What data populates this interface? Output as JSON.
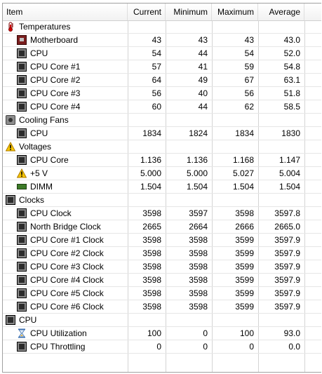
{
  "columns": {
    "item": "Item",
    "current": "Current",
    "minimum": "Minimum",
    "maximum": "Maximum",
    "average": "Average"
  },
  "rows": [
    {
      "type": "group",
      "icon": "thermometer-icon",
      "label": "Temperatures"
    },
    {
      "type": "item",
      "icon": "motherboard-icon",
      "label": "Motherboard",
      "current": "43",
      "minimum": "43",
      "maximum": "43",
      "average": "43.0"
    },
    {
      "type": "item",
      "icon": "cpu-chip-icon",
      "label": "CPU",
      "current": "54",
      "minimum": "44",
      "maximum": "54",
      "average": "52.0"
    },
    {
      "type": "item",
      "icon": "cpu-chip-icon",
      "label": "CPU Core #1",
      "current": "57",
      "minimum": "41",
      "maximum": "59",
      "average": "54.8"
    },
    {
      "type": "item",
      "icon": "cpu-chip-icon",
      "label": "CPU Core #2",
      "current": "64",
      "minimum": "49",
      "maximum": "67",
      "average": "63.1"
    },
    {
      "type": "item",
      "icon": "cpu-chip-icon",
      "label": "CPU Core #3",
      "current": "56",
      "minimum": "40",
      "maximum": "56",
      "average": "51.8"
    },
    {
      "type": "item",
      "icon": "cpu-chip-icon",
      "label": "CPU Core #4",
      "current": "60",
      "minimum": "44",
      "maximum": "62",
      "average": "58.5"
    },
    {
      "type": "group",
      "icon": "fan-icon",
      "label": "Cooling Fans"
    },
    {
      "type": "item",
      "icon": "cpu-chip-icon",
      "label": "CPU",
      "current": "1834",
      "minimum": "1824",
      "maximum": "1834",
      "average": "1830"
    },
    {
      "type": "group",
      "icon": "warning-icon",
      "label": "Voltages"
    },
    {
      "type": "item",
      "icon": "cpu-chip-icon",
      "label": "CPU Core",
      "current": "1.136",
      "minimum": "1.136",
      "maximum": "1.168",
      "average": "1.147"
    },
    {
      "type": "item",
      "icon": "warning-icon",
      "label": "+5 V",
      "current": "5.000",
      "minimum": "5.000",
      "maximum": "5.027",
      "average": "5.004"
    },
    {
      "type": "item",
      "icon": "dimm-icon",
      "label": "DIMM",
      "current": "1.504",
      "minimum": "1.504",
      "maximum": "1.504",
      "average": "1.504"
    },
    {
      "type": "group",
      "icon": "clock-chip-icon",
      "label": "Clocks"
    },
    {
      "type": "item",
      "icon": "cpu-chip-icon",
      "label": "CPU Clock",
      "current": "3598",
      "minimum": "3597",
      "maximum": "3598",
      "average": "3597.8"
    },
    {
      "type": "item",
      "icon": "northbridge-icon",
      "label": "North Bridge Clock",
      "current": "2665",
      "minimum": "2664",
      "maximum": "2666",
      "average": "2665.0"
    },
    {
      "type": "item",
      "icon": "cpu-chip-icon",
      "label": "CPU Core #1 Clock",
      "current": "3598",
      "minimum": "3598",
      "maximum": "3599",
      "average": "3597.9"
    },
    {
      "type": "item",
      "icon": "cpu-chip-icon",
      "label": "CPU Core #2 Clock",
      "current": "3598",
      "minimum": "3598",
      "maximum": "3599",
      "average": "3597.9"
    },
    {
      "type": "item",
      "icon": "cpu-chip-icon",
      "label": "CPU Core #3 Clock",
      "current": "3598",
      "minimum": "3598",
      "maximum": "3599",
      "average": "3597.9"
    },
    {
      "type": "item",
      "icon": "cpu-chip-icon",
      "label": "CPU Core #4 Clock",
      "current": "3598",
      "minimum": "3598",
      "maximum": "3599",
      "average": "3597.9"
    },
    {
      "type": "item",
      "icon": "cpu-chip-icon",
      "label": "CPU Core #5 Clock",
      "current": "3598",
      "minimum": "3598",
      "maximum": "3599",
      "average": "3597.9"
    },
    {
      "type": "item",
      "icon": "cpu-chip-icon",
      "label": "CPU Core #6 Clock",
      "current": "3598",
      "minimum": "3598",
      "maximum": "3599",
      "average": "3597.9"
    },
    {
      "type": "group",
      "icon": "cpu-chip-icon",
      "label": "CPU"
    },
    {
      "type": "item",
      "icon": "hourglass-icon",
      "label": "CPU Utilization",
      "current": "100",
      "minimum": "0",
      "maximum": "100",
      "average": "93.0"
    },
    {
      "type": "item",
      "icon": "cpu-chip-icon",
      "label": "CPU Throttling",
      "current": "0",
      "minimum": "0",
      "maximum": "0",
      "average": "0.0"
    }
  ]
}
